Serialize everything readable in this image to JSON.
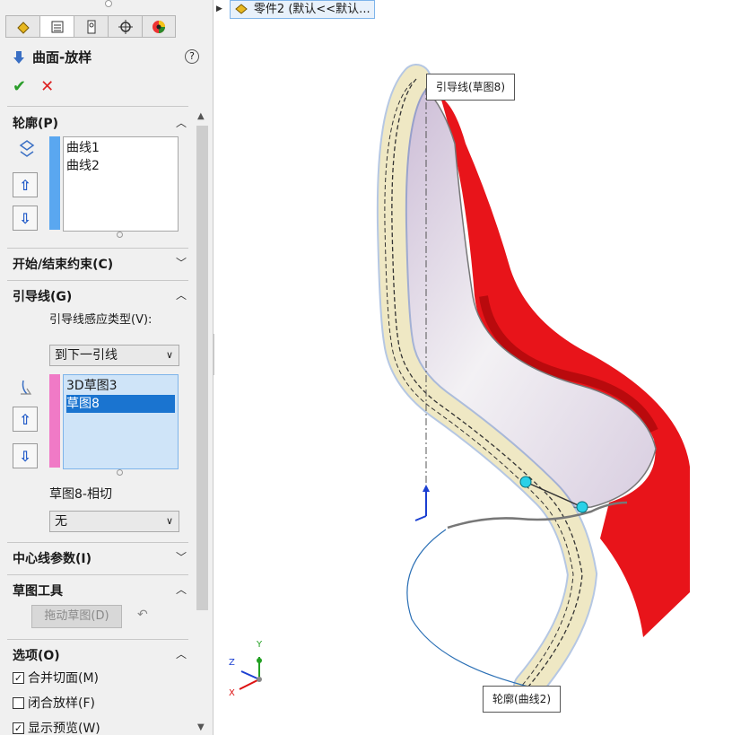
{
  "panel": {
    "title": "曲面-放样",
    "help_label": "?",
    "ok_label": "✔",
    "cancel_label": "✕",
    "sections": {
      "profiles": {
        "header": "轮廓(P)",
        "items": [
          "曲线1",
          "曲线2"
        ]
      },
      "start_end": {
        "header": "开始/结束约束(C)"
      },
      "guides": {
        "header": "引导线(G)",
        "influence_label": "引导线感应类型(V):",
        "influence_value": "到下一引线",
        "items": [
          "3D草图3",
          "草图8"
        ],
        "selected_index": 1,
        "tangency_label": "草图8-相切",
        "tangency_value": "无"
      },
      "centerline": {
        "header": "中心线参数(I)"
      },
      "sketch_tools": {
        "header": "草图工具",
        "drag_label": "拖动草图(D)"
      },
      "options": {
        "header": "选项(O)",
        "checks": [
          {
            "label": "合并切面(M)",
            "checked": true
          },
          {
            "label": "闭合放样(F)",
            "checked": false
          },
          {
            "label": "显示预览(W)",
            "checked": true
          }
        ]
      }
    },
    "colors": {
      "profile_bar": "#5aa7f0",
      "guide_bar": "#f07ac6"
    }
  },
  "viewport": {
    "tree_label": "零件2  (默认<<默认...",
    "callout_guide": "引导线(草图8)",
    "callout_profile": "轮廓(曲线2)",
    "triad": {
      "x": "X",
      "y": "Y",
      "z": "Z"
    },
    "colors": {
      "red_face": "#e8141a",
      "guide_strip": "#efe8c4"
    }
  }
}
